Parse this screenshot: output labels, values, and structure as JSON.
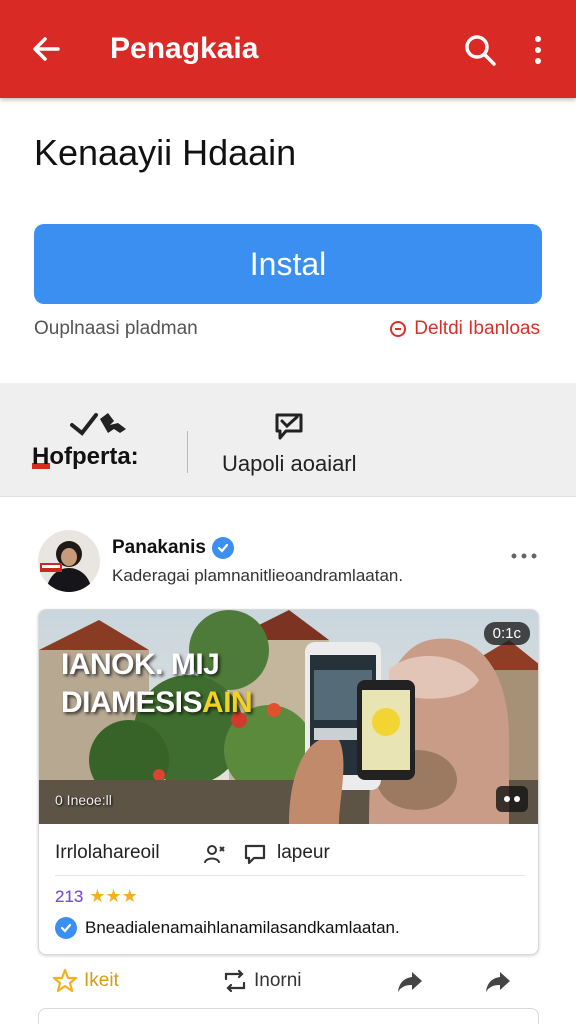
{
  "appbar": {
    "title": "Penagkaia",
    "back_icon": "arrow-back-icon",
    "search_icon": "search-icon",
    "more_icon": "more-vert-icon",
    "color": "#d92a26"
  },
  "app": {
    "name": "Kenaayii Hdaain"
  },
  "install": {
    "label": "Instal",
    "color": "#3b8ff0"
  },
  "meta": {
    "left": "Ouplnaasi pladman",
    "right": "Deltdi Ibanloas"
  },
  "tabs": [
    {
      "label": "Hofperta:",
      "icon": "hands-icon"
    },
    {
      "label": "Uapoli aoaiarl",
      "icon": "message-check-icon"
    }
  ],
  "post": {
    "author": "Panakanis",
    "subtitle": "Kaderagai plamnanitlieoandramlaatan.",
    "more_icon": "more-horiz-icon"
  },
  "card": {
    "headline_line1": "IANOK. MIJ",
    "headline_line2a": "DIAMESIS",
    "headline_line2b": "AIN",
    "duration": "0:1c",
    "caption": "0 Ineoe:ll",
    "row1_left": "Irrlolahareoil",
    "row1_right": "lapeur",
    "rating_number": "213",
    "rating_stars": "★★★",
    "description": "Bneadialenamaihlanamilasandkamlaatan."
  },
  "actions": [
    {
      "label": "Ikeit",
      "icon": "star-outline-icon"
    },
    {
      "label": "Inorni",
      "icon": "repeat-icon"
    },
    {
      "label": "",
      "icon": "share-icon"
    },
    {
      "label": "",
      "icon": "forward-icon"
    }
  ]
}
